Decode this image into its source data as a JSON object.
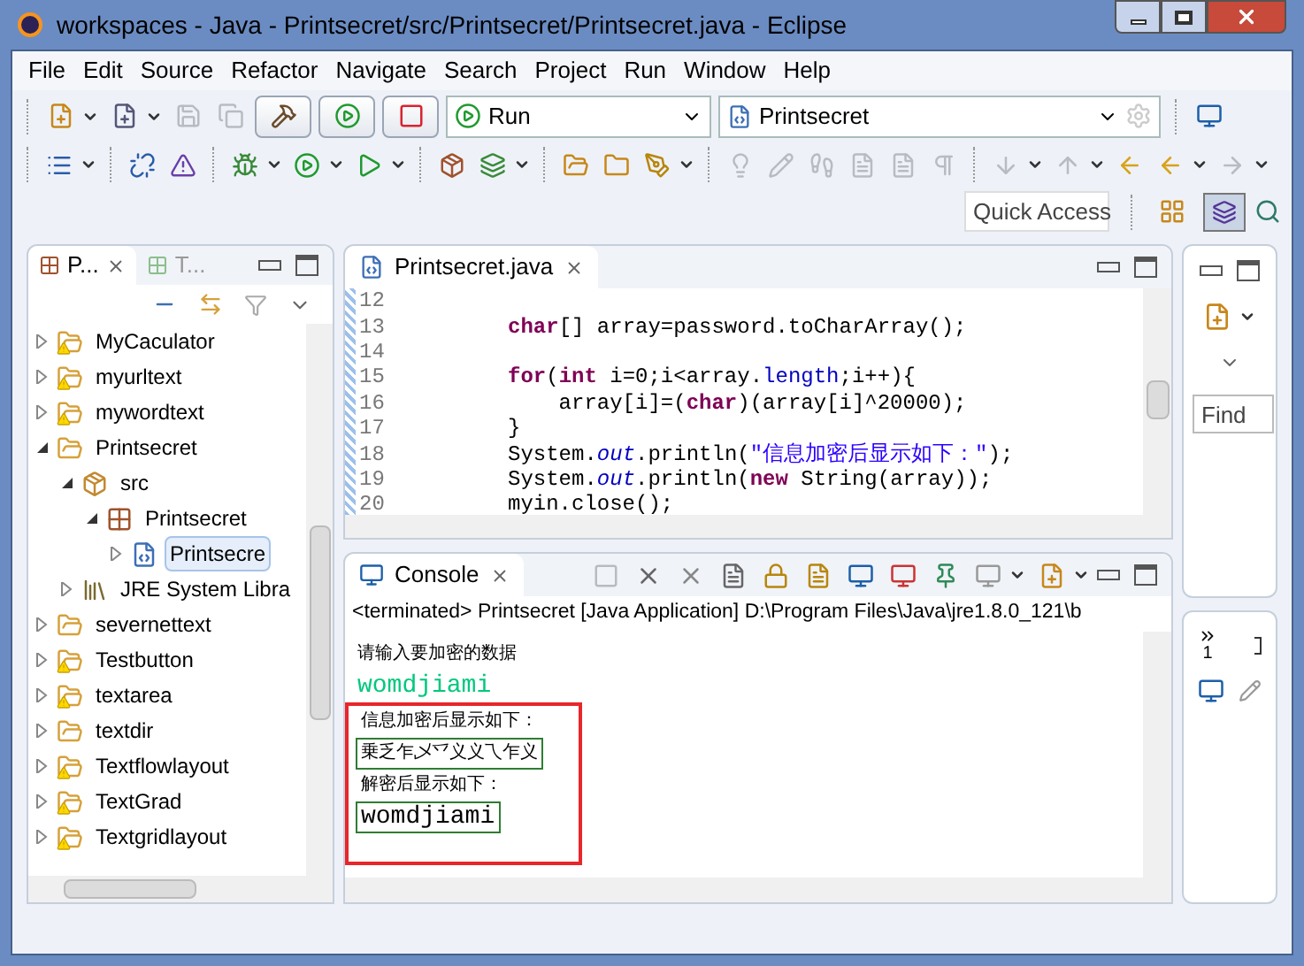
{
  "window": {
    "title": "workspaces - Java - Printsecret/src/Printsecret/Printsecret.java - Eclipse"
  },
  "menu": [
    "File",
    "Edit",
    "Source",
    "Refactor",
    "Navigate",
    "Search",
    "Project",
    "Run",
    "Window",
    "Help"
  ],
  "toolbar": {
    "run_config": "Run",
    "launch_target": "Printsecret",
    "quick_access": "Quick Access"
  },
  "package_explorer": {
    "tabs": [
      {
        "label": "P...",
        "selected": true
      },
      {
        "label": "T...",
        "selected": false
      }
    ],
    "tree": [
      {
        "label": "MyCaculator",
        "kind": "project",
        "warning": true,
        "expanded": false,
        "selected": false
      },
      {
        "label": "myurltext",
        "kind": "project",
        "warning": true,
        "expanded": false,
        "selected": false
      },
      {
        "label": "mywordtext",
        "kind": "project",
        "warning": true,
        "expanded": false,
        "selected": false
      },
      {
        "label": "Printsecret",
        "kind": "project",
        "warning": false,
        "expanded": true,
        "selected": false,
        "children": [
          {
            "label": "src",
            "kind": "source-folder",
            "warning": false,
            "expanded": true,
            "selected": false,
            "children": [
              {
                "label": "Printsecret",
                "kind": "package",
                "warning": false,
                "expanded": true,
                "selected": false,
                "children": [
                  {
                    "label": "Printsecre",
                    "kind": "java-file",
                    "warning": false,
                    "expanded": false,
                    "selected": true
                  }
                ]
              }
            ]
          },
          {
            "label": "JRE System Libra",
            "kind": "library",
            "warning": false,
            "expanded": false,
            "selected": false
          }
        ]
      },
      {
        "label": "severnettext",
        "kind": "project",
        "warning": false,
        "expanded": false,
        "selected": false
      },
      {
        "label": "Testbutton",
        "kind": "project",
        "warning": true,
        "expanded": false,
        "selected": false
      },
      {
        "label": "textarea",
        "kind": "project",
        "warning": true,
        "expanded": false,
        "selected": false
      },
      {
        "label": "textdir",
        "kind": "project",
        "warning": false,
        "expanded": false,
        "selected": false
      },
      {
        "label": "Textflowlayout",
        "kind": "project",
        "warning": true,
        "expanded": false,
        "selected": false
      },
      {
        "label": "TextGrad",
        "kind": "project",
        "warning": true,
        "expanded": false,
        "selected": false
      },
      {
        "label": "Textgridlayout",
        "kind": "project",
        "warning": true,
        "expanded": false,
        "selected": false
      }
    ]
  },
  "editor": {
    "tab": {
      "label": "Printsecret.java",
      "selected": true
    },
    "lines": [
      {
        "number": "12"
      },
      {
        "number": "13",
        "tokens": [
          {
            "text": "char",
            "kind": "keyword"
          },
          {
            "text": "[] array=password.toCharArray();",
            "kind": "plain"
          }
        ]
      },
      {
        "number": "14"
      },
      {
        "number": "15",
        "tokens": [
          {
            "text": "for",
            "kind": "keyword"
          },
          {
            "text": "(",
            "kind": "plain"
          },
          {
            "text": "int",
            "kind": "keyword"
          },
          {
            "text": " i=0;i<array.",
            "kind": "plain"
          },
          {
            "text": "length",
            "kind": "field"
          },
          {
            "text": ";i++){",
            "kind": "plain"
          }
        ]
      },
      {
        "number": "16",
        "tokens": [
          {
            "text": "    array[i]=(",
            "kind": "plain"
          },
          {
            "text": "char",
            "kind": "keyword"
          },
          {
            "text": ")(array[i]^20000);",
            "kind": "plain"
          }
        ]
      },
      {
        "number": "17",
        "tokens": [
          {
            "text": "}",
            "kind": "plain"
          }
        ]
      },
      {
        "number": "18",
        "tokens": [
          {
            "text": "System.",
            "kind": "plain"
          },
          {
            "text": "out",
            "kind": "static-field"
          },
          {
            "text": ".println(",
            "kind": "plain"
          },
          {
            "text": "\"信息加密后显示如下：\"",
            "kind": "string"
          },
          {
            "text": ");",
            "kind": "plain"
          }
        ]
      },
      {
        "number": "19",
        "tokens": [
          {
            "text": "System.",
            "kind": "plain"
          },
          {
            "text": "out",
            "kind": "static-field"
          },
          {
            "text": ".println(",
            "kind": "plain"
          },
          {
            "text": "new",
            "kind": "keyword"
          },
          {
            "text": " String(array));",
            "kind": "plain"
          }
        ]
      },
      {
        "number": "20",
        "tokens": [
          {
            "text": "myin.close();",
            "kind": "plain"
          }
        ]
      }
    ]
  },
  "console": {
    "tab": {
      "label": "Console",
      "selected": true
    },
    "status": "<terminated> Printsecret [Java Application] D:\\Program Files\\Java\\jre1.8.0_121\\b",
    "lines": [
      {
        "text": "请输入要加密的数据",
        "kind": "output",
        "boxed": false
      },
      {
        "text": "womdjiami",
        "kind": "input",
        "boxed": false
      }
    ],
    "annotated_lines": [
      {
        "text": "信息加密后显示如下：",
        "kind": "output",
        "boxed": false
      },
      {
        "text": "乗乏乍乄乊义义乁乍义",
        "kind": "output",
        "boxed": true
      },
      {
        "text": "解密后显示如下：",
        "kind": "output",
        "boxed": false
      },
      {
        "text": "womdjiami",
        "kind": "result",
        "boxed": true
      }
    ]
  },
  "right_panel": {
    "find_placeholder": "Find",
    "overflow_count": "1"
  }
}
